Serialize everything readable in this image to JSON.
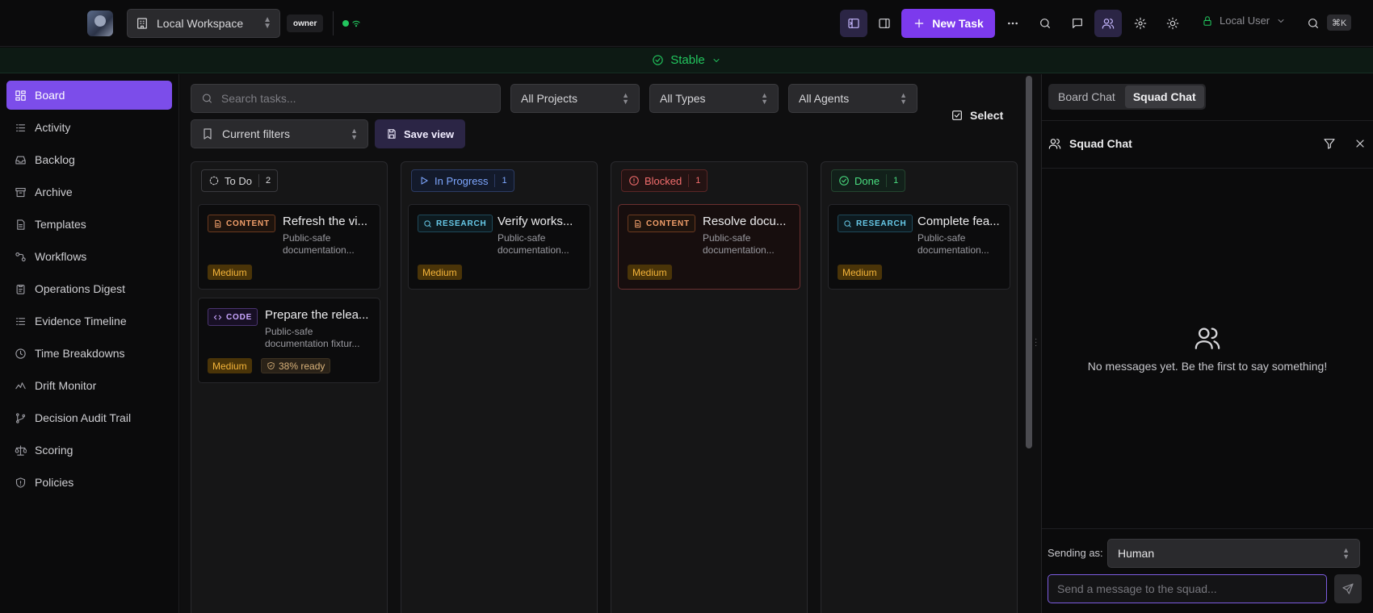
{
  "topbar": {
    "workspace": "Local Workspace",
    "role_badge": "owner",
    "new_task_label": "New Task",
    "user_label": "Local User",
    "shortcut": "⌘K"
  },
  "status_bar": {
    "label": "Stable",
    "color": "#22c55e"
  },
  "sidebar": {
    "items": [
      {
        "label": "Board",
        "icon": "board-icon",
        "active": true
      },
      {
        "label": "Activity",
        "icon": "activity-icon"
      },
      {
        "label": "Backlog",
        "icon": "inbox-icon"
      },
      {
        "label": "Archive",
        "icon": "archive-icon"
      },
      {
        "label": "Templates",
        "icon": "file-icon"
      },
      {
        "label": "Workflows",
        "icon": "workflow-icon"
      },
      {
        "label": "Operations Digest",
        "icon": "clipboard-icon"
      },
      {
        "label": "Evidence Timeline",
        "icon": "list-icon"
      },
      {
        "label": "Time Breakdowns",
        "icon": "clock-icon"
      },
      {
        "label": "Drift Monitor",
        "icon": "pulse-icon"
      },
      {
        "label": "Decision Audit Trail",
        "icon": "branch-icon"
      },
      {
        "label": "Scoring",
        "icon": "scale-icon"
      },
      {
        "label": "Policies",
        "icon": "shield-icon"
      }
    ]
  },
  "filters": {
    "search_placeholder": "Search tasks...",
    "projects": "All Projects",
    "types": "All Types",
    "agents": "All Agents",
    "current_filters": "Current filters",
    "save_view": "Save view",
    "select": "Select"
  },
  "board": {
    "columns": [
      {
        "label": "To Do",
        "count": "2"
      },
      {
        "label": "In Progress",
        "count": "1"
      },
      {
        "label": "Blocked",
        "count": "1"
      },
      {
        "label": "Done",
        "count": "1"
      }
    ],
    "cards": {
      "todo_1": {
        "tag": "CONTENT",
        "title": "Refresh the vi...",
        "desc": "Public-safe documentation...",
        "priority": "Medium"
      },
      "todo_2": {
        "tag": "CODE",
        "title": "Prepare the relea...",
        "desc": "Public-safe documentation fixtur...",
        "priority": "Medium",
        "ready": "38% ready"
      },
      "progress_1": {
        "tag": "RESEARCH",
        "title": "Verify works...",
        "desc": "Public-safe documentation...",
        "priority": "Medium"
      },
      "blocked_1": {
        "tag": "CONTENT",
        "title": "Resolve docu...",
        "desc": "Public-safe documentation...",
        "priority": "Medium"
      },
      "done_1": {
        "tag": "RESEARCH",
        "title": "Complete fea...",
        "desc": "Public-safe documentation...",
        "priority": "Medium"
      }
    }
  },
  "chat": {
    "tabs": [
      "Board Chat",
      "Squad Chat"
    ],
    "active_tab": "Squad Chat",
    "header": "Squad Chat",
    "empty_message": "No messages yet. Be the first to say something!",
    "sending_as_label": "Sending as:",
    "sending_as_value": "Human",
    "input_placeholder": "Send a message to the squad..."
  }
}
